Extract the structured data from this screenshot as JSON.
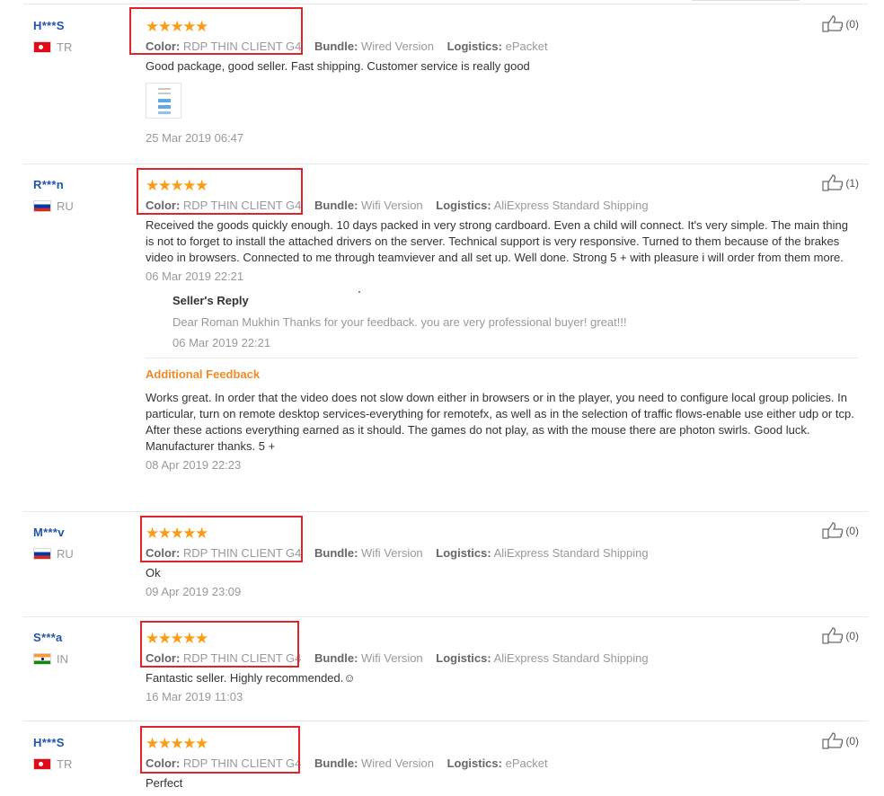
{
  "reviews": [
    {
      "user": "H***S",
      "country": "TR",
      "stars": 5,
      "color_label": "Color:",
      "color_value": "RDP THIN CLIENT G4",
      "bundle_label": "Bundle:",
      "bundle_value": "Wired Version",
      "logistics_label": "Logistics:",
      "logistics_value": "ePacket",
      "text": "Good package, good seller. Fast shipping. Customer service is really good",
      "date": "25 Mar 2019 06:47",
      "likes": "(0)"
    },
    {
      "user": "R***n",
      "country": "RU",
      "stars": 5,
      "color_label": "Color:",
      "color_value": "RDP THIN CLIENT G4",
      "bundle_label": "Bundle:",
      "bundle_value": "Wifi Version",
      "logistics_label": "Logistics:",
      "logistics_value": "AliExpress Standard Shipping",
      "text": "Received the goods quickly enough. 10 days packed in very strong cardboard. Even a child will connect. It's very simple. The main thing is not to forget to install the attached drivers on the server. Technical support is very responsive. Turned to them because of the brakes video in browsers. Connected to me through teamviever and all set up. Well done. Strong 5 + with pleasure i will order from them more.",
      "date": "06 Mar 2019 22:21",
      "likes": "(1)",
      "seller_reply_title": "Seller's Reply",
      "seller_reply_text": "Dear Roman Mukhin Thanks for your feedback. you are very professional buyer! great!!!",
      "seller_reply_date": "06 Mar 2019 22:21",
      "additional_title": "Additional Feedback",
      "additional_text": "Works great. In order that the video does not slow down either in browsers or in the player, you need to configure local group policies. In particular, turn on remote desktop services-everything for remotefx, as well as in the selection of traffic flows-enable use either udp or tcp. After these actions everything earned as it should. The games do not play, as with the mouse there are photon swirls. Good luck. Manufacturer thanks. 5 +",
      "additional_date": "08 Apr 2019 22:23"
    },
    {
      "user": "M***v",
      "country": "RU",
      "stars": 5,
      "color_label": "Color:",
      "color_value": "RDP THIN CLIENT G4",
      "bundle_label": "Bundle:",
      "bundle_value": "Wifi Version",
      "logistics_label": "Logistics:",
      "logistics_value": "AliExpress Standard Shipping",
      "text": "Ok",
      "date": "09 Apr 2019 23:09",
      "likes": "(0)"
    },
    {
      "user": "S***a",
      "country": "IN",
      "stars": 5,
      "color_label": "Color:",
      "color_value": "RDP THIN CLIENT G4",
      "bundle_label": "Bundle:",
      "bundle_value": "Wifi Version",
      "logistics_label": "Logistics:",
      "logistics_value": "AliExpress Standard Shipping",
      "text": "Fantastic seller. Highly recommended.☺",
      "date": "16 Mar 2019 11:03",
      "likes": "(0)"
    },
    {
      "user": "H***S",
      "country": "TR",
      "stars": 5,
      "color_label": "Color:",
      "color_value": "RDP THIN CLIENT G4",
      "bundle_label": "Bundle:",
      "bundle_value": "Wired Version",
      "logistics_label": "Logistics:",
      "logistics_value": "ePacket",
      "text": "Perfect",
      "likes": "(0)"
    }
  ],
  "icons": {
    "star": "star-icon",
    "like": "thumbs-up-icon",
    "flag_tr": "turkey-flag-icon",
    "flag_ru": "russia-flag-icon",
    "flag_in": "india-flag-icon"
  },
  "colors": {
    "star": "#f89d15",
    "username": "#2156a5",
    "highlight_box": "#e0242a",
    "additional_feedback": "#f08a24"
  }
}
